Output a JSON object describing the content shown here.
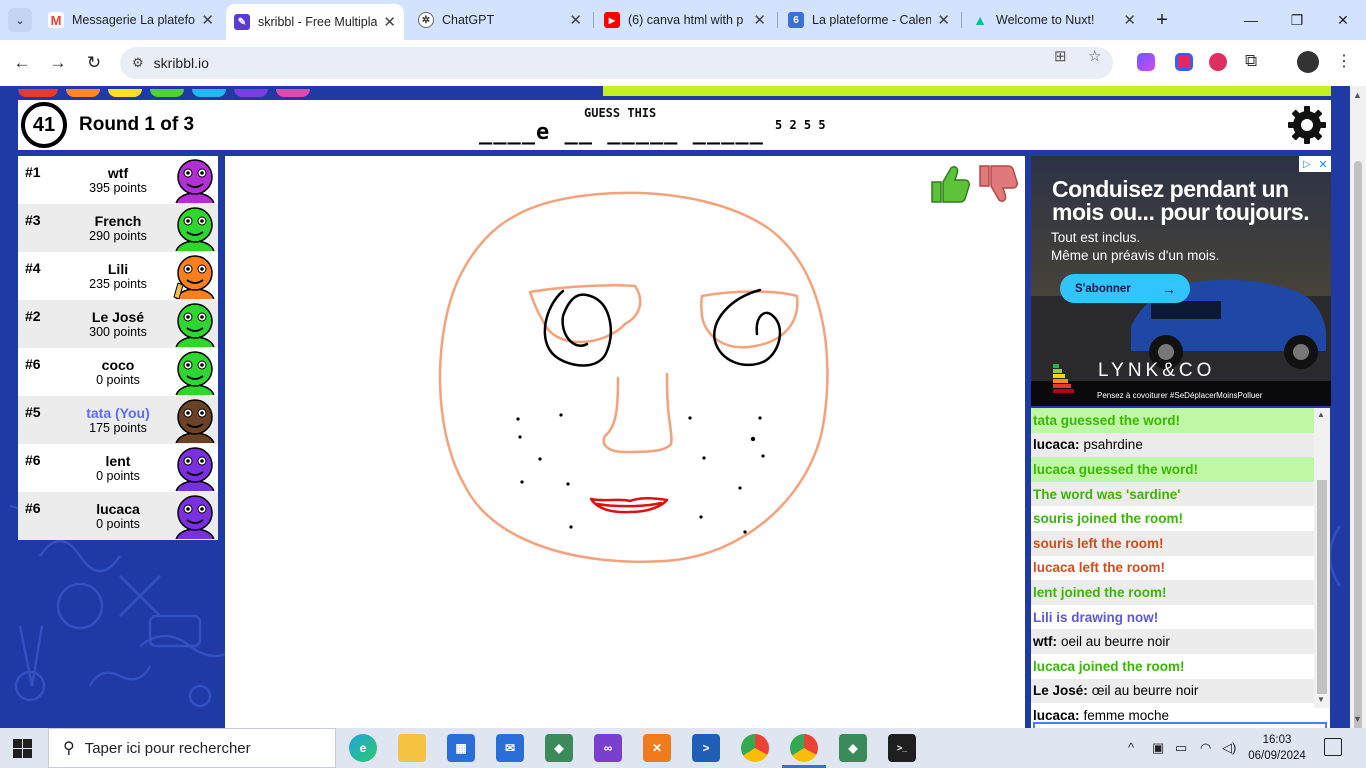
{
  "browser": {
    "tabs": [
      {
        "title": "Messagerie La platefo",
        "favicon": "gmail-icon",
        "active": false
      },
      {
        "title": "skribbl - Free Multipla",
        "favicon": "skribbl-icon",
        "active": true
      },
      {
        "title": "ChatGPT",
        "favicon": "chatgpt-icon",
        "active": false
      },
      {
        "title": "(6) canva html with p",
        "favicon": "youtube-icon",
        "active": false
      },
      {
        "title": "La plateforme - Calen",
        "favicon": "calendar-icon",
        "active": false
      },
      {
        "title": "Welcome to Nuxt!",
        "favicon": "nuxt-icon",
        "active": false
      }
    ],
    "url": "skribbl.io"
  },
  "game": {
    "timer": "41",
    "round": "Round 1 of 3",
    "guess_label": "GUESS THIS",
    "word_hint": "____e __ _____ _____",
    "word_lengths": "5 2 5 5",
    "players": [
      {
        "rank": "#1",
        "name": "wtf",
        "points": "395 points",
        "avatar_color": "#b22fd6",
        "you": false,
        "drawing": false
      },
      {
        "rank": "#3",
        "name": "French",
        "points": "290 points",
        "avatar_color": "#2fd62f",
        "you": false,
        "drawing": false
      },
      {
        "rank": "#4",
        "name": "Lili",
        "points": "235 points",
        "avatar_color": "#ff7f1f",
        "you": false,
        "drawing": true
      },
      {
        "rank": "#2",
        "name": "Le José",
        "points": "300 points",
        "avatar_color": "#2fd62f",
        "you": false,
        "drawing": false
      },
      {
        "rank": "#6",
        "name": "coco",
        "points": "0 points",
        "avatar_color": "#2fd62f",
        "you": false,
        "drawing": false
      },
      {
        "rank": "#5",
        "name": "tata (You)",
        "points": "175 points",
        "avatar_color": "#6b4226",
        "you": true,
        "drawing": false
      },
      {
        "rank": "#6",
        "name": "lent",
        "points": "0 points",
        "avatar_color": "#7a2fe0",
        "you": false,
        "drawing": false
      },
      {
        "rank": "#6",
        "name": "lucaca",
        "points": "0 points",
        "avatar_color": "#7a2fe0",
        "you": false,
        "drawing": false
      }
    ],
    "chat": [
      {
        "who": "",
        "text": "tata guessed the word!",
        "type": "guessed",
        "color": "#38b800"
      },
      {
        "who": "lucaca:",
        "text": "psahrdine",
        "type": "normal",
        "color": "#000000"
      },
      {
        "who": "",
        "text": "lucaca guessed the word!",
        "type": "guessed",
        "color": "#38b800"
      },
      {
        "who": "",
        "text": "The word was 'sardine'",
        "type": "system",
        "color": "#38b800"
      },
      {
        "who": "",
        "text": "souris joined the room!",
        "type": "system",
        "color": "#38b800"
      },
      {
        "who": "",
        "text": "souris left the room!",
        "type": "system",
        "color": "#d54b1c"
      },
      {
        "who": "",
        "text": "lucaca left the room!",
        "type": "system",
        "color": "#d54b1c"
      },
      {
        "who": "",
        "text": "lent joined the room!",
        "type": "system",
        "color": "#38b800"
      },
      {
        "who": "",
        "text": "Lili is drawing now!",
        "type": "system",
        "color": "#5c59d9"
      },
      {
        "who": "wtf:",
        "text": "oeil au beurre noir",
        "type": "normal",
        "color": "#000000"
      },
      {
        "who": "",
        "text": "lucaca joined the room!",
        "type": "system",
        "color": "#38b800"
      },
      {
        "who": "Le José:",
        "text": "œil au beurre noir",
        "type": "normal",
        "color": "#000000"
      },
      {
        "who": "lucaca:",
        "text": "femme moche",
        "type": "normal",
        "color": "#000000"
      }
    ]
  },
  "ad": {
    "headline": "Conduisez pendant un mois ou... pour toujours.",
    "line1": "Tout est inclus.",
    "line2": "Même un préavis d'un mois.",
    "cta": "S'abonner",
    "brand": "LYNK&CO",
    "footnote": "Pensez à covoiturer #SeDéplacerMoinsPolluer"
  },
  "taskbar": {
    "search_placeholder": "Taper ici pour rechercher",
    "time": "16:03",
    "date": "06/09/2024"
  },
  "colors": {
    "page_background": "#1f3aa4",
    "hint_bar": "#c6ef1f",
    "drawing_skin": "#f4a27c",
    "drawing_eyes": "#000000",
    "drawing_lips": "#e01010"
  }
}
